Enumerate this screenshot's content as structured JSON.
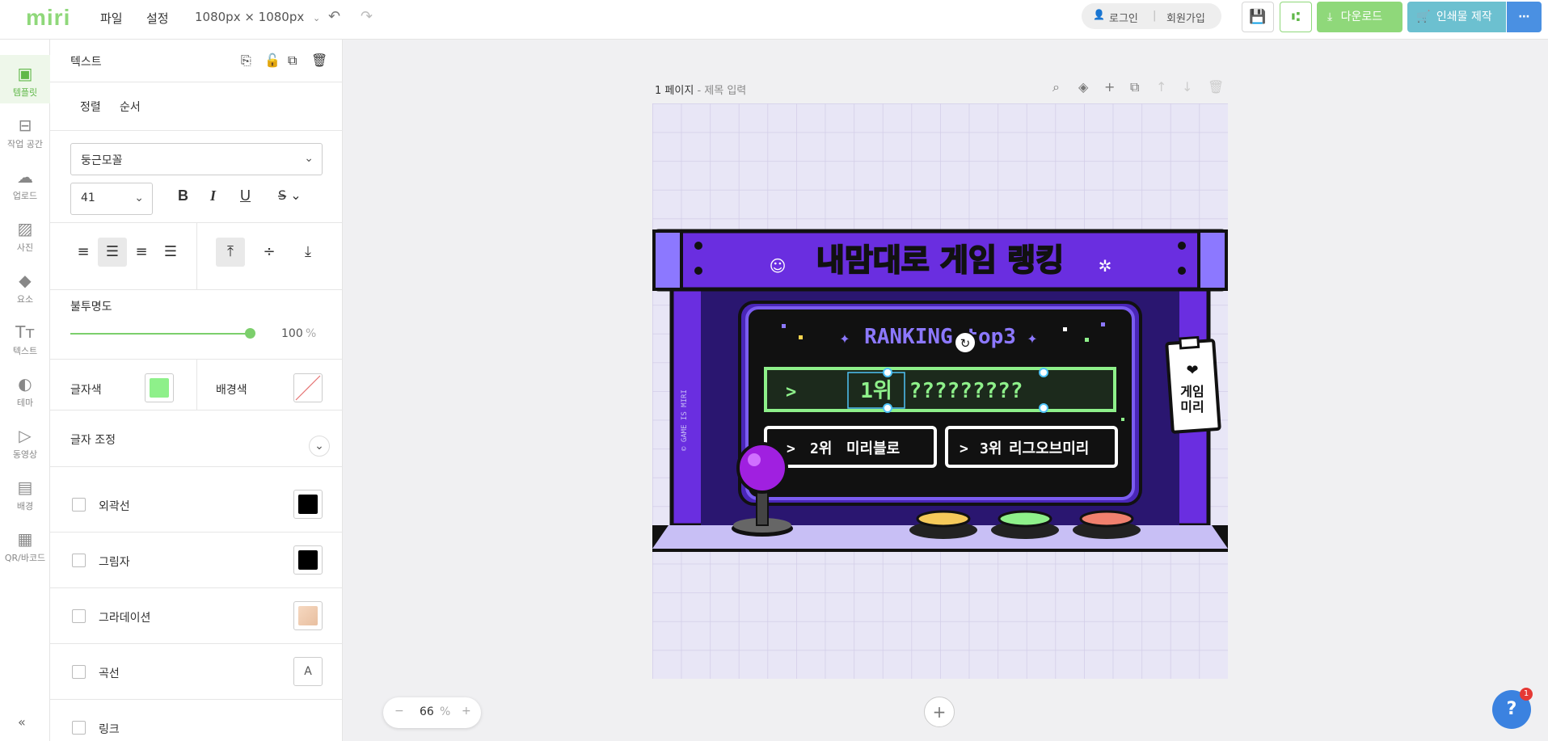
{
  "app": {
    "logo": "miri"
  },
  "topbar": {
    "menu_file": "파일",
    "menu_settings": "설정",
    "canvas_size": "1080px × 1080px",
    "login": "로그인",
    "signup": "회원가입",
    "download": "다운로드",
    "print": "인쇄물 제작",
    "more": "⋯"
  },
  "leftnav": [
    {
      "label": "템플릿",
      "icon": "template-icon",
      "glyph": "▣"
    },
    {
      "label": "작업 공간",
      "icon": "archive-icon",
      "glyph": "⊟"
    },
    {
      "label": "업로드",
      "icon": "upload-cloud-icon",
      "glyph": "☁"
    },
    {
      "label": "사진",
      "icon": "photo-icon",
      "glyph": "▨"
    },
    {
      "label": "요소",
      "icon": "elements-icon",
      "glyph": "◆"
    },
    {
      "label": "텍스트",
      "icon": "text-icon",
      "glyph": "Tт"
    },
    {
      "label": "테마",
      "icon": "palette-icon",
      "glyph": "◐"
    },
    {
      "label": "동영상",
      "icon": "video-play-icon",
      "glyph": "▷"
    },
    {
      "label": "배경",
      "icon": "background-icon",
      "glyph": "▤"
    },
    {
      "label": "QR/바코드",
      "icon": "qr-code-icon",
      "glyph": "▦"
    }
  ],
  "panel": {
    "title": "텍스트",
    "tab_align": "정렬",
    "tab_order": "순서",
    "font_family": "둥근모꼴",
    "font_size": "41",
    "bold": "B",
    "italic": "I",
    "underline": "U",
    "opacity_label": "불투명도",
    "opacity_value": "100",
    "opacity_unit": "%",
    "opacity": 1.0,
    "text_color_label": "글자색",
    "bg_color_label": "배경색",
    "text_adjust_label": "글자 조정",
    "outline_label": "외곽선",
    "shadow_label": "그림자",
    "gradient_label": "그라데이션",
    "curve_label": "곡선",
    "link_label": "링크",
    "curve_glyph": "A"
  },
  "colors": {
    "text_color": "#8ef08a",
    "outline_color": "#000000",
    "shadow_color": "#000000",
    "gradient_color": "#f0c8a8",
    "accent": "#7ccf6c",
    "purple": "#6a2ee0"
  },
  "canvas": {
    "page_label": "1 페이지",
    "page_title_placeholder": "- 제목 입력",
    "zoom_value": "66",
    "zoom_unit": "%"
  },
  "design": {
    "heading": "내맘대로 게임 랭킹",
    "ranking_label": "RANKING top3",
    "rank1_pos": "1위",
    "rank1_name": "?????????",
    "rank2_pos": "2위",
    "rank2_name": "미리블로",
    "rank3_pos": "3위",
    "rank3_name": "리그오브미리",
    "side_text": "© GAME IS MIRI",
    "tag_line1": "게임",
    "tag_line2": "미리"
  },
  "help": {
    "badge_count": "1",
    "glyph": "?"
  }
}
